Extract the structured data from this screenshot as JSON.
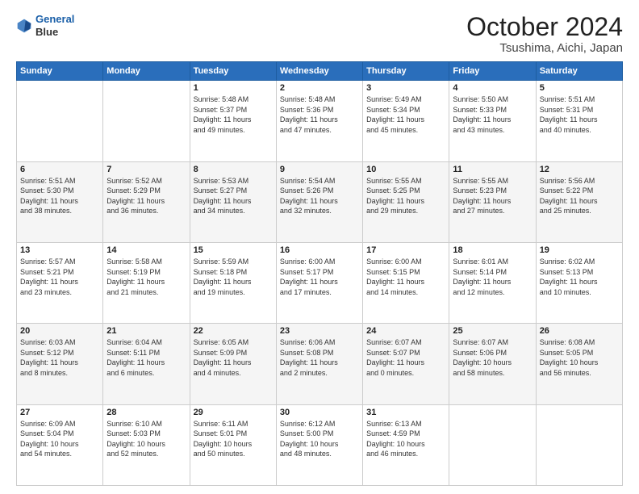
{
  "header": {
    "logo_line1": "General",
    "logo_line2": "Blue",
    "main_title": "October 2024",
    "subtitle": "Tsushima, Aichi, Japan"
  },
  "calendar": {
    "headers": [
      "Sunday",
      "Monday",
      "Tuesday",
      "Wednesday",
      "Thursday",
      "Friday",
      "Saturday"
    ],
    "weeks": [
      [
        {
          "day": "",
          "info": ""
        },
        {
          "day": "",
          "info": ""
        },
        {
          "day": "1",
          "info": "Sunrise: 5:48 AM\nSunset: 5:37 PM\nDaylight: 11 hours\nand 49 minutes."
        },
        {
          "day": "2",
          "info": "Sunrise: 5:48 AM\nSunset: 5:36 PM\nDaylight: 11 hours\nand 47 minutes."
        },
        {
          "day": "3",
          "info": "Sunrise: 5:49 AM\nSunset: 5:34 PM\nDaylight: 11 hours\nand 45 minutes."
        },
        {
          "day": "4",
          "info": "Sunrise: 5:50 AM\nSunset: 5:33 PM\nDaylight: 11 hours\nand 43 minutes."
        },
        {
          "day": "5",
          "info": "Sunrise: 5:51 AM\nSunset: 5:31 PM\nDaylight: 11 hours\nand 40 minutes."
        }
      ],
      [
        {
          "day": "6",
          "info": "Sunrise: 5:51 AM\nSunset: 5:30 PM\nDaylight: 11 hours\nand 38 minutes."
        },
        {
          "day": "7",
          "info": "Sunrise: 5:52 AM\nSunset: 5:29 PM\nDaylight: 11 hours\nand 36 minutes."
        },
        {
          "day": "8",
          "info": "Sunrise: 5:53 AM\nSunset: 5:27 PM\nDaylight: 11 hours\nand 34 minutes."
        },
        {
          "day": "9",
          "info": "Sunrise: 5:54 AM\nSunset: 5:26 PM\nDaylight: 11 hours\nand 32 minutes."
        },
        {
          "day": "10",
          "info": "Sunrise: 5:55 AM\nSunset: 5:25 PM\nDaylight: 11 hours\nand 29 minutes."
        },
        {
          "day": "11",
          "info": "Sunrise: 5:55 AM\nSunset: 5:23 PM\nDaylight: 11 hours\nand 27 minutes."
        },
        {
          "day": "12",
          "info": "Sunrise: 5:56 AM\nSunset: 5:22 PM\nDaylight: 11 hours\nand 25 minutes."
        }
      ],
      [
        {
          "day": "13",
          "info": "Sunrise: 5:57 AM\nSunset: 5:21 PM\nDaylight: 11 hours\nand 23 minutes."
        },
        {
          "day": "14",
          "info": "Sunrise: 5:58 AM\nSunset: 5:19 PM\nDaylight: 11 hours\nand 21 minutes."
        },
        {
          "day": "15",
          "info": "Sunrise: 5:59 AM\nSunset: 5:18 PM\nDaylight: 11 hours\nand 19 minutes."
        },
        {
          "day": "16",
          "info": "Sunrise: 6:00 AM\nSunset: 5:17 PM\nDaylight: 11 hours\nand 17 minutes."
        },
        {
          "day": "17",
          "info": "Sunrise: 6:00 AM\nSunset: 5:15 PM\nDaylight: 11 hours\nand 14 minutes."
        },
        {
          "day": "18",
          "info": "Sunrise: 6:01 AM\nSunset: 5:14 PM\nDaylight: 11 hours\nand 12 minutes."
        },
        {
          "day": "19",
          "info": "Sunrise: 6:02 AM\nSunset: 5:13 PM\nDaylight: 11 hours\nand 10 minutes."
        }
      ],
      [
        {
          "day": "20",
          "info": "Sunrise: 6:03 AM\nSunset: 5:12 PM\nDaylight: 11 hours\nand 8 minutes."
        },
        {
          "day": "21",
          "info": "Sunrise: 6:04 AM\nSunset: 5:11 PM\nDaylight: 11 hours\nand 6 minutes."
        },
        {
          "day": "22",
          "info": "Sunrise: 6:05 AM\nSunset: 5:09 PM\nDaylight: 11 hours\nand 4 minutes."
        },
        {
          "day": "23",
          "info": "Sunrise: 6:06 AM\nSunset: 5:08 PM\nDaylight: 11 hours\nand 2 minutes."
        },
        {
          "day": "24",
          "info": "Sunrise: 6:07 AM\nSunset: 5:07 PM\nDaylight: 11 hours\nand 0 minutes."
        },
        {
          "day": "25",
          "info": "Sunrise: 6:07 AM\nSunset: 5:06 PM\nDaylight: 10 hours\nand 58 minutes."
        },
        {
          "day": "26",
          "info": "Sunrise: 6:08 AM\nSunset: 5:05 PM\nDaylight: 10 hours\nand 56 minutes."
        }
      ],
      [
        {
          "day": "27",
          "info": "Sunrise: 6:09 AM\nSunset: 5:04 PM\nDaylight: 10 hours\nand 54 minutes."
        },
        {
          "day": "28",
          "info": "Sunrise: 6:10 AM\nSunset: 5:03 PM\nDaylight: 10 hours\nand 52 minutes."
        },
        {
          "day": "29",
          "info": "Sunrise: 6:11 AM\nSunset: 5:01 PM\nDaylight: 10 hours\nand 50 minutes."
        },
        {
          "day": "30",
          "info": "Sunrise: 6:12 AM\nSunset: 5:00 PM\nDaylight: 10 hours\nand 48 minutes."
        },
        {
          "day": "31",
          "info": "Sunrise: 6:13 AM\nSunset: 4:59 PM\nDaylight: 10 hours\nand 46 minutes."
        },
        {
          "day": "",
          "info": ""
        },
        {
          "day": "",
          "info": ""
        }
      ]
    ]
  }
}
